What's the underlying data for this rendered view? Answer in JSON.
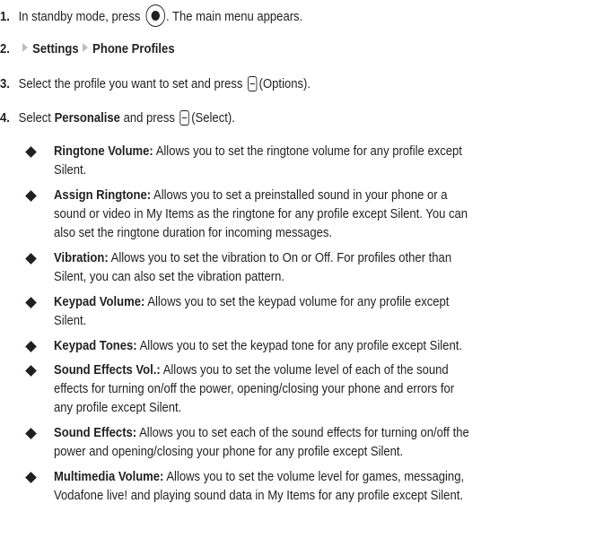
{
  "steps": [
    {
      "num": "1.",
      "pre": "In standby mode, press",
      "post": ". The main menu appears."
    },
    {
      "num": "2.",
      "menu1": "Settings",
      "menu2": "Phone Profiles"
    },
    {
      "num": "3.",
      "pre": "Select the profile you want to set and press",
      "post": "(Options)."
    },
    {
      "num": "4.",
      "pre": "Select",
      "bold": "Personalise",
      "mid": "and press",
      "post": "(Select)."
    }
  ],
  "bullets": [
    {
      "term": "Ringtone Volume:",
      "lines": [
        "Allows you to set the ringtone volume for any profile except",
        "Silent."
      ]
    },
    {
      "term": "Assign Ringtone:",
      "lines": [
        "Allows you to set a preinstalled sound in your phone or a",
        "sound or video in My Items as the ringtone for any profile except Silent. You can",
        "also set the ringtone duration for incoming messages."
      ]
    },
    {
      "term": "Vibration:",
      "lines": [
        "Allows you to set the vibration to On or Off. For profiles other than",
        "Silent, you can also set the vibration pattern."
      ]
    },
    {
      "term": "Keypad Volume:",
      "lines": [
        "Allows you to set the keypad volume for any profile except",
        "Silent."
      ]
    },
    {
      "term": "Keypad Tones:",
      "lines": [
        "Allows you to set the keypad tone for any profile except Silent."
      ]
    },
    {
      "term": "Sound Effects Vol.:",
      "lines": [
        "Allows you to set the volume level of each of the sound",
        "effects for turning on/off the power, opening/closing your phone and errors for",
        "any profile except Silent."
      ]
    },
    {
      "term": "Sound Effects:",
      "lines": [
        "Allows you to set each of the sound effects for turning on/off the",
        "power and opening/closing your phone for any profile except Silent."
      ]
    },
    {
      "term": "Multimedia Volume:",
      "lines": [
        "Allows you to set the volume level for games, messaging,",
        "Vodafone live! and playing sound data in My Items for any profile except Silent."
      ]
    }
  ]
}
